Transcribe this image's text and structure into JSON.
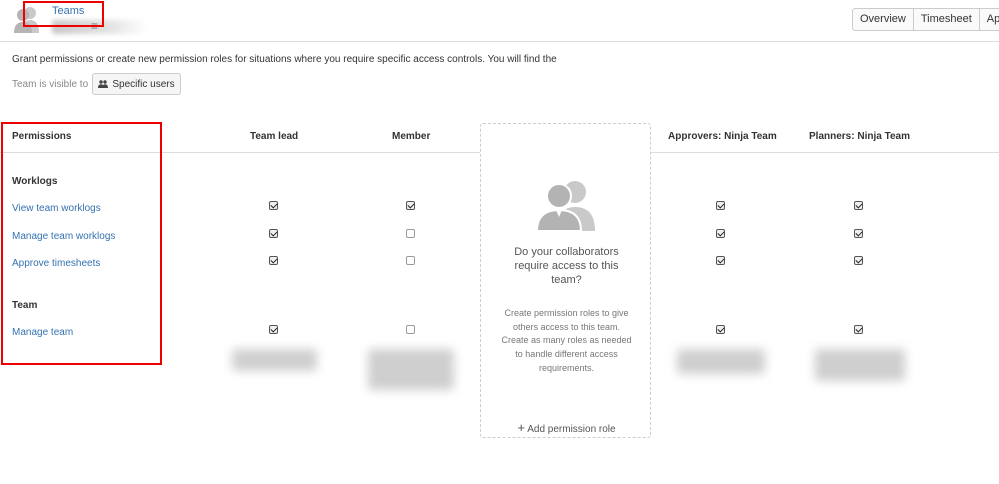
{
  "header": {
    "breadcrumb": "Teams",
    "team_name_menu_glyph": "≡",
    "tabs": [
      "Overview",
      "Timesheet",
      "Appro"
    ]
  },
  "description": "Grant permissions or create new permission roles for situations where you require specific access controls. You will find the",
  "visibility": {
    "label": "Team is visible to",
    "button": "Specific users",
    "button_icon": "users-icon"
  },
  "table": {
    "permissions_header": "Permissions",
    "columns": [
      "Team lead",
      "Member",
      "Approvers: Ninja Team",
      "Planners: Ninja Team"
    ],
    "sections": [
      {
        "title": "Worklogs",
        "rows": [
          {
            "label": "View team worklogs",
            "checks": [
              true,
              true,
              true,
              true
            ]
          },
          {
            "label": "Manage team worklogs",
            "checks": [
              true,
              false,
              true,
              true
            ]
          },
          {
            "label": "Approve timesheets",
            "checks": [
              true,
              false,
              true,
              true
            ]
          }
        ]
      },
      {
        "title": "Team",
        "rows": [
          {
            "label": "Manage team",
            "checks": [
              true,
              false,
              true,
              true
            ]
          }
        ]
      }
    ]
  },
  "add_role_card": {
    "icon": "collaborators-icon",
    "question": "Do your collaborators require access to this team?",
    "text": "Create permission roles to give others access to this team. Create as many roles as needed to handle different access requirements.",
    "add_label": "Add permission role"
  }
}
